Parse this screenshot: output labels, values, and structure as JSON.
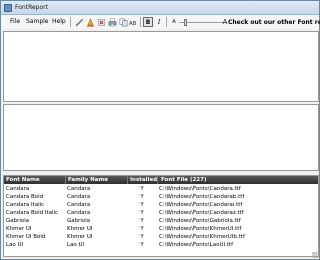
{
  "window": {
    "title": "FontReport"
  },
  "menu": [
    {
      "label": "File"
    },
    {
      "label": "Sample"
    },
    {
      "label": "Help"
    }
  ],
  "toolbar": {
    "bold_label": "B",
    "italic_label": "I",
    "size_small_label": "A",
    "size_large_label": "A",
    "promo_text": "Check out our other Font related"
  },
  "table": {
    "columns": [
      {
        "label": "Font Name"
      },
      {
        "label": "Family Name"
      },
      {
        "label": "Installed"
      },
      {
        "label": "Font File (227)"
      }
    ],
    "rows": [
      {
        "name": "Candara",
        "family": "Candara",
        "installed": "Y",
        "file": "C:\\Windows\\Fonts\\Candara.ttf"
      },
      {
        "name": "Candara Bold",
        "family": "Candara",
        "installed": "Y",
        "file": "C:\\Windows\\Fonts\\Candarab.ttf"
      },
      {
        "name": "Candara Italic",
        "family": "Candara",
        "installed": "Y",
        "file": "C:\\Windows\\Fonts\\Candarai.ttf"
      },
      {
        "name": "Candara Bold Italic",
        "family": "Candara",
        "installed": "Y",
        "file": "C:\\Windows\\Fonts\\Candaraz.ttf"
      },
      {
        "name": "Gabriola",
        "family": "Gabriola",
        "installed": "Y",
        "file": "C:\\Windows\\Fonts\\Gabriola.ttf"
      },
      {
        "name": "Khmer UI",
        "family": "Khmer UI",
        "installed": "Y",
        "file": "C:\\Windows\\Fonts\\KhmerUI.ttf"
      },
      {
        "name": "Khmer UI Bold",
        "family": "Khmer UI",
        "installed": "Y",
        "file": "C:\\Windows\\Fonts\\KhmerUIb.ttf"
      },
      {
        "name": "Lao UI",
        "family": "Lao UI",
        "installed": "Y",
        "file": "C:\\Windows\\Fonts\\LaoUI.ttf"
      }
    ]
  }
}
